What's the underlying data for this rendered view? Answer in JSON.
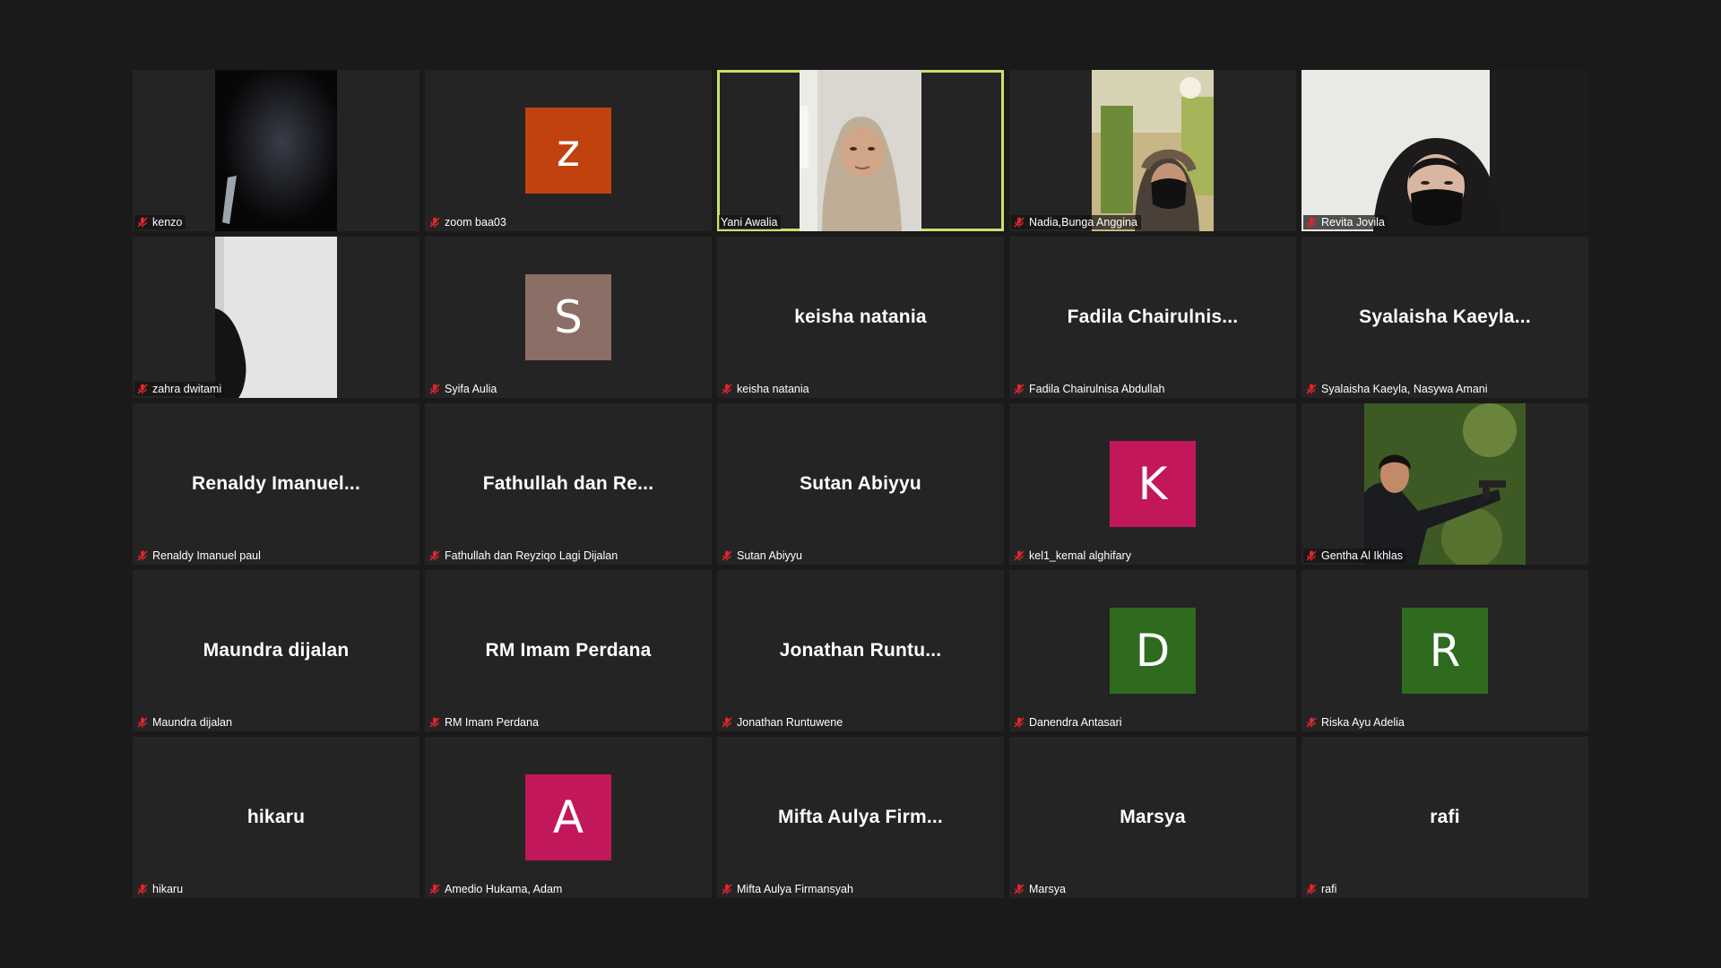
{
  "participants": [
    {
      "name": "kenzo",
      "muted": true,
      "kind": "video",
      "video": "dark-room"
    },
    {
      "name": "zoom baa03",
      "muted": true,
      "kind": "avatar",
      "initial": "z",
      "color": "#c1410f"
    },
    {
      "name": "Yani Awalia",
      "muted": false,
      "kind": "video",
      "video": "hijab-woman",
      "active": true
    },
    {
      "name": "Nadia,Bunga Anggina",
      "muted": true,
      "kind": "video",
      "video": "masked-girl-green"
    },
    {
      "name": "Revita Jovila",
      "muted": true,
      "kind": "video",
      "video": "masked-girl-light"
    },
    {
      "name": "zahra dwitami",
      "muted": true,
      "kind": "video",
      "video": "white-wall"
    },
    {
      "name": "Syifa Aulia",
      "muted": true,
      "kind": "avatar",
      "initial": "S",
      "color": "#8b6e65"
    },
    {
      "name": "keisha natania",
      "muted": true,
      "kind": "text",
      "display": "keisha natania"
    },
    {
      "name": "Fadila Chairulnisa Abdullah",
      "muted": true,
      "kind": "text",
      "display": "Fadila  Chairulnis..."
    },
    {
      "name": "Syalaisha Kaeyla, Nasywa Amani",
      "muted": true,
      "kind": "text",
      "display": "Syalaisha  Kaeyla..."
    },
    {
      "name": "Renaldy Imanuel paul",
      "muted": true,
      "kind": "text",
      "display": "Renaldy  Imanuel..."
    },
    {
      "name": "Fathullah dan Reyziqo Lagi Dijalan",
      "muted": true,
      "kind": "text",
      "display": "Fathullah  dan  Re..."
    },
    {
      "name": "Sutan Abiyyu",
      "muted": true,
      "kind": "text",
      "display": "Sutan Abiyyu"
    },
    {
      "name": "kel1_kemal alghifary",
      "muted": true,
      "kind": "avatar",
      "initial": "K",
      "color": "#c2185b"
    },
    {
      "name": "Gentha Al Ikhlas",
      "muted": true,
      "kind": "video",
      "video": "man-with-gun"
    },
    {
      "name": "Maundra dijalan",
      "muted": true,
      "kind": "text",
      "display": "Maundra dijalan"
    },
    {
      "name": "RM Imam Perdana",
      "muted": true,
      "kind": "text",
      "display": "RM Imam Perdana"
    },
    {
      "name": "Jonathan Runtuwene",
      "muted": true,
      "kind": "text",
      "display": "Jonathan  Runtu..."
    },
    {
      "name": "Danendra Antasari",
      "muted": true,
      "kind": "avatar",
      "initial": "D",
      "color": "#2e6b1f"
    },
    {
      "name": "Riska Ayu Adelia",
      "muted": true,
      "kind": "avatar",
      "initial": "R",
      "color": "#2e6b1f"
    },
    {
      "name": "hikaru",
      "muted": true,
      "kind": "text",
      "display": "hikaru"
    },
    {
      "name": "Amedio Hukama, Adam",
      "muted": true,
      "kind": "avatar",
      "initial": "A",
      "color": "#c2185b"
    },
    {
      "name": "Mifta Aulya Firmansyah",
      "muted": true,
      "kind": "text",
      "display": "Mifta  Aulya  Firm..."
    },
    {
      "name": "Marsya",
      "muted": true,
      "kind": "text",
      "display": "Marsya"
    },
    {
      "name": "rafi",
      "muted": true,
      "kind": "text",
      "display": "rafi"
    }
  ],
  "icons": {
    "muted": "mic-muted-icon"
  },
  "colors": {
    "active_speaker_border": "#c5e36b",
    "tile_bg": "#242424",
    "page_bg": "#1a1a1a",
    "mute_red": "#e0262b"
  }
}
